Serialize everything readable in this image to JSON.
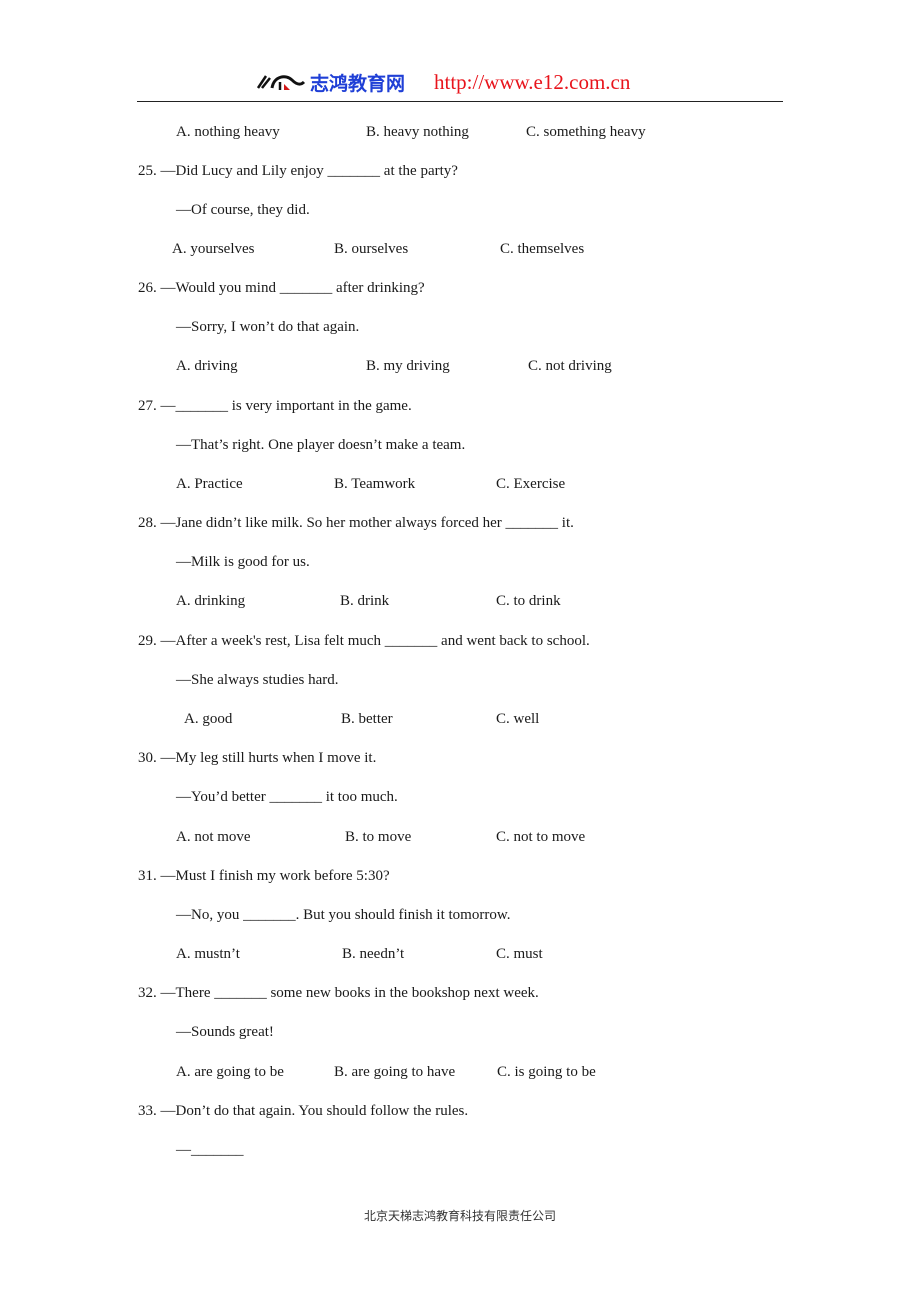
{
  "header": {
    "brand": "志鸿教育网",
    "url": "http://www.e12.com.cn",
    "colors": {
      "brand": "#1f3fd6",
      "url": "#e8141c"
    }
  },
  "prev_options": [
    "A. nothing heavy",
    "B. heavy nothing",
    "C. something heavy"
  ],
  "questions": [
    {
      "q": "25. —Did Lucy and Lily enjoy _______ at the party?",
      "a": "—Of course, they did.",
      "options": [
        "A. yourselves",
        "B. ourselves",
        "C. themselves"
      ]
    },
    {
      "q": "26. —Would you mind _______ after drinking?",
      "a": "—Sorry, I won’t do that again.",
      "options": [
        "A. driving",
        "B. my driving",
        "C. not driving"
      ]
    },
    {
      "q": "27. —_______ is very important in the game.",
      "a": "—That’s right. One player doesn’t make a team.",
      "options": [
        "A. Practice",
        "B. Teamwork",
        "C. Exercise"
      ]
    },
    {
      "q": "28. —Jane didn’t like milk. So her mother always forced her _______ it.",
      "a": "—Milk is good for us.",
      "options": [
        "A. drinking",
        "B. drink",
        "C. to drink"
      ]
    },
    {
      "q": "29. —After a week's rest, Lisa felt much _______ and went back to school.",
      "a": "—She always studies hard.",
      "options": [
        "A. good",
        "B. better",
        "C. well"
      ]
    },
    {
      "q": "30. —My leg still hurts when I move it.",
      "a": "—You’d better _______ it too much.",
      "options": [
        "A. not move",
        "B. to move",
        "C. not to move"
      ]
    },
    {
      "q": "31. —Must I finish my work before 5:30?",
      "a": "—No, you _______. But you should finish it tomorrow.",
      "options": [
        "A. mustn’t",
        "B. needn’t",
        "C. must"
      ]
    },
    {
      "q": "32. —There _______ some new books in the bookshop next week.",
      "a": "—Sounds great!",
      "options": [
        "A. are going to be",
        "B. are going to have",
        "C. is going to be"
      ]
    },
    {
      "q": "33. —Don’t do that again. You should follow the rules.",
      "a": "—_______"
    }
  ],
  "footer": "北京天梯志鸿教育科技有限责任公司"
}
